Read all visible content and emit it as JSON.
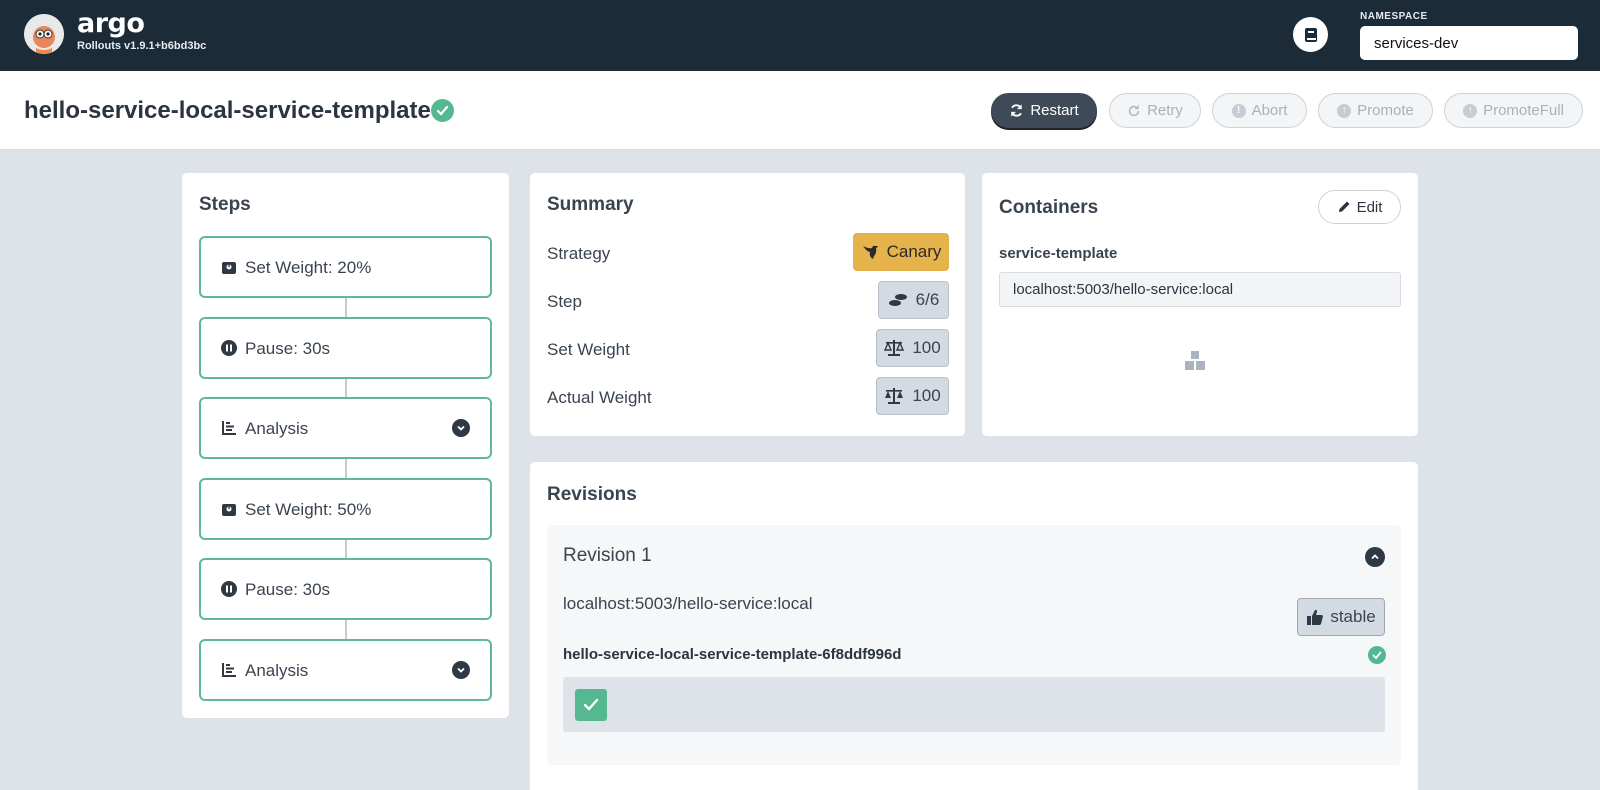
{
  "header": {
    "brand": "argo",
    "version": "Rollouts v1.9.1+b6bd3bc",
    "namespace_label": "NAMESPACE",
    "namespace_value": "services-dev"
  },
  "rollout": {
    "title": "hello-service-local-service-template",
    "status": "healthy"
  },
  "actions": [
    {
      "label": "Restart",
      "enabled": true,
      "icon": "refresh-icon"
    },
    {
      "label": "Retry",
      "enabled": false,
      "icon": "retry-icon"
    },
    {
      "label": "Abort",
      "enabled": false,
      "icon": "exclamation-icon"
    },
    {
      "label": "Promote",
      "enabled": false,
      "icon": "arrow-up-icon"
    },
    {
      "label": "PromoteFull",
      "enabled": false,
      "icon": "arrow-up-icon"
    }
  ],
  "steps": {
    "title": "Steps",
    "items": [
      {
        "label": "Set Weight: 20%",
        "icon": "weight-icon"
      },
      {
        "label": "Pause: 30s",
        "icon": "pause-icon"
      },
      {
        "label": "Analysis",
        "icon": "chart-icon",
        "expandable": true
      },
      {
        "label": "Set Weight: 50%",
        "icon": "weight-icon"
      },
      {
        "label": "Pause: 30s",
        "icon": "pause-icon"
      },
      {
        "label": "Analysis",
        "icon": "chart-icon",
        "expandable": true
      }
    ]
  },
  "summary": {
    "title": "Summary",
    "strategy_label": "Strategy",
    "strategy_value": "Canary",
    "step_label": "Step",
    "step_value": "6/6",
    "set_weight_label": "Set Weight",
    "set_weight_value": "100",
    "actual_weight_label": "Actual Weight",
    "actual_weight_value": "100"
  },
  "containers": {
    "title": "Containers",
    "edit_label": "Edit",
    "name": "service-template",
    "image": "localhost:5003/hello-service:local"
  },
  "revisions": {
    "title": "Revisions",
    "items": [
      {
        "title": "Revision 1",
        "image": "localhost:5003/hello-service:local",
        "badge": "stable",
        "replicaset": "hello-service-local-service-template-6f8ddf996d",
        "pods_ready": 1
      }
    ]
  },
  "colors": {
    "header_bg": "#1b2b38",
    "success": "#54b890",
    "canary": "#e5b24c",
    "page_bg": "#dee3ea"
  }
}
